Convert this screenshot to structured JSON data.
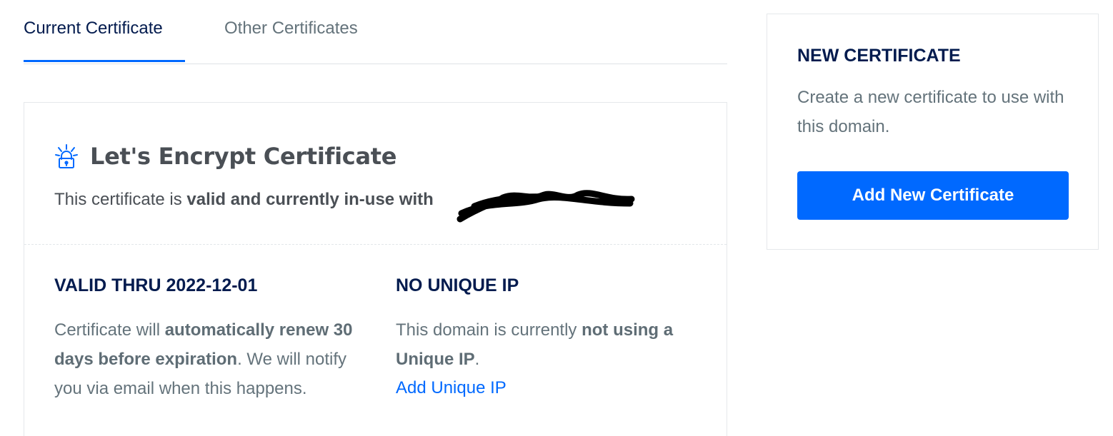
{
  "tabs": {
    "current": "Current Certificate",
    "other": "Other Certificates"
  },
  "certificate": {
    "icon": "lets-encrypt-lock-icon",
    "title": "Let's Encrypt Certificate",
    "status_prefix": "This certificate is ",
    "status_bold": "valid and currently in-use with",
    "valid": {
      "title": "VALID THRU 2022-12-01",
      "text_1": "Certificate will ",
      "text_bold": "automatically renew 30 days before expiration",
      "text_2": ". We will notify you via email when this happens."
    },
    "ip": {
      "title": "NO UNIQUE IP",
      "text_1": "This domain is currently ",
      "text_bold": "not using a Unique IP",
      "text_2": ".",
      "link": "Add Unique IP"
    }
  },
  "new_certificate": {
    "title": "NEW CERTIFICATE",
    "description": "Create a new certificate to use with this domain.",
    "button": "Add New Certificate"
  },
  "colors": {
    "accent": "#0069ff",
    "heading": "#031b4e",
    "muted": "#64737b"
  }
}
